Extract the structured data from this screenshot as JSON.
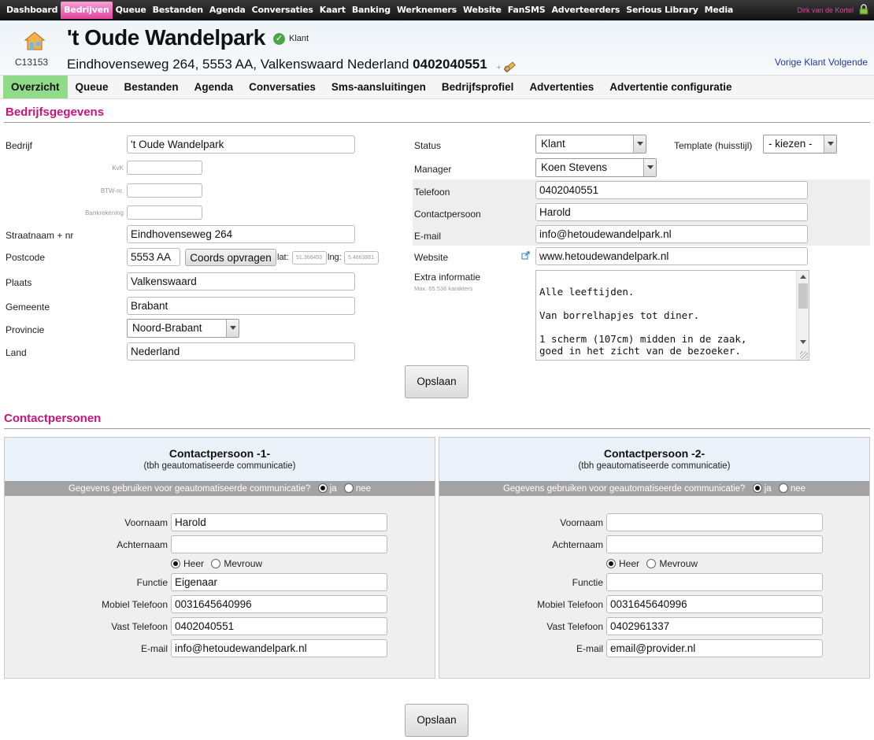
{
  "topnav": {
    "items": [
      "Dashboard",
      "Bedrijven",
      "Queue",
      "Bestanden",
      "Agenda",
      "Conversaties",
      "Kaart",
      "Banking",
      "Werknemers",
      "Website",
      "FanSMS",
      "Adverteerders",
      "Serious Library",
      "Media"
    ],
    "active_index": 1,
    "user": "Dirk van de Kortel"
  },
  "header": {
    "company_id": "C13153",
    "title": "'t Oude Wandelpark",
    "status": "Klant",
    "address": "Eindhovenseweg 264, 5553 AA, Valkenswaard Nederland",
    "phone": "0402040551",
    "prev_label": "Vorige Klant",
    "next_label": "Volgende"
  },
  "subtabs": {
    "items": [
      "Overzicht",
      "Queue",
      "Bestanden",
      "Agenda",
      "Conversaties",
      "Sms-aansluitingen",
      "Bedrijfsprofiel",
      "Advertenties",
      "Advertentie configuratie"
    ],
    "active_index": 0
  },
  "bedrijf": {
    "section_title": "Bedrijfsgegevens",
    "bedrijf_label": "Bedrijf",
    "bedrijf_value": "'t Oude Wandelpark",
    "kvk_label": "KvK",
    "btw_label": "BTW-nr.",
    "bank_label": "Bankrekening",
    "straat_label": "Straatnaam + nr",
    "straat_value": "Eindhovenseweg 264",
    "postcode_label": "Postcode",
    "postcode_value": "5553 AA",
    "coords_button": "Coords opvragen",
    "lat_label": "lat:",
    "lat_value": "51.366459",
    "lng_label": "lng:",
    "lng_value": "5.4663881",
    "plaats_label": "Plaats",
    "plaats_value": "Valkenswaard",
    "gemeente_label": "Gemeente",
    "gemeente_value": "Brabant",
    "provincie_label": "Provincie",
    "provincie_value": "Noord-Brabant",
    "land_label": "Land",
    "land_value": "Nederland",
    "status_label": "Status",
    "status_value": "Klant",
    "template_label": "Template (huisstijl)",
    "template_value": "- kiezen -",
    "manager_label": "Manager",
    "manager_value": "Koen Stevens",
    "telefoon_label": "Telefoon",
    "telefoon_value": "0402040551",
    "contact_label": "Contactpersoon",
    "contact_value": "Harold",
    "email_label": "E-mail",
    "email_value": "info@hetoudewandelpark.nl",
    "website_label": "Website",
    "website_value": "www.hetoudewandelpark.nl",
    "extra_label": "Extra informatie",
    "extra_hint": "Max. 65.536 karakters",
    "extra_value": "Alle leeftijden.\n\nVan borrelhapjes tot diner.\n\n1 scherm (107cm) midden in de zaak,\ngoed in het zicht van de bezoeker.",
    "save_label": "Opslaan"
  },
  "contacts": {
    "section_title": "Contactpersonen",
    "subtitle": "(tbh geautomatiseerde communicatie)",
    "question": "Gegevens gebruiken voor geautomatiseerde communicatie?",
    "ja": "ja",
    "nee": "nee",
    "labels": {
      "voornaam": "Voornaam",
      "achternaam": "Achternaam",
      "heer": "Heer",
      "mevrouw": "Mevrouw",
      "functie": "Functie",
      "mobiel": "Mobiel Telefoon",
      "vast": "Vast Telefoon",
      "email": "E-mail"
    },
    "c1": {
      "title": "Contactpersoon -1-",
      "voornaam": "Harold",
      "achternaam": "",
      "functie": "Eigenaar",
      "mobiel_placeholder": "0031645640996",
      "vast": "0402040551",
      "email": "info@hetoudewandelpark.nl"
    },
    "c2": {
      "title": "Contactpersoon -2-",
      "voornaam": "",
      "achternaam": "",
      "functie": "",
      "mobiel_placeholder": "0031645640996",
      "vast_placeholder": "0402961337",
      "email_placeholder": "email@provider.nl"
    },
    "save_label": "Opslaan"
  }
}
